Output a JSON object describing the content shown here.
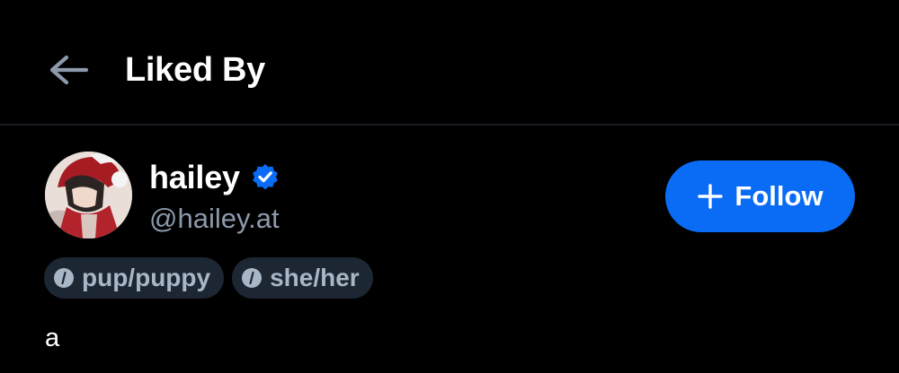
{
  "header": {
    "title": "Liked By",
    "back_icon": "arrow-left-icon"
  },
  "user": {
    "display_name": "hailey",
    "handle": "@hailey.at",
    "verified": true,
    "verified_icon": "verified-check-icon",
    "bio": "a"
  },
  "follow_button": {
    "label": "Follow",
    "icon": "plus-icon",
    "color": "#0a6cf5"
  },
  "labels": [
    {
      "text": "pup/puppy",
      "icon": "info-icon"
    },
    {
      "text": "she/her",
      "icon": "info-icon"
    }
  ],
  "colors": {
    "background": "#000000",
    "text_primary": "#ffffff",
    "text_secondary": "#8c99ab",
    "pill_bg": "#1d2733",
    "accent": "#0a6cf5"
  }
}
